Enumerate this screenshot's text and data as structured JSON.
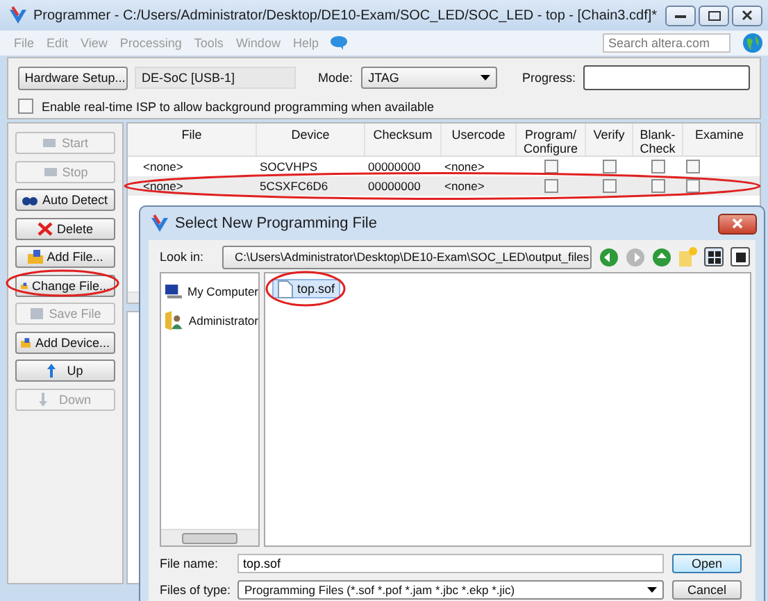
{
  "window": {
    "title": "Programmer - C:/Users/Administrator/Desktop/DE10-Exam/SOC_LED/SOC_LED - top - [Chain3.cdf]*"
  },
  "menu": [
    {
      "label": "File",
      "disabled": true
    },
    {
      "label": "Edit",
      "disabled": true
    },
    {
      "label": "View",
      "disabled": true
    },
    {
      "label": "Processing",
      "disabled": true
    },
    {
      "label": "Tools",
      "disabled": true
    },
    {
      "label": "Window",
      "disabled": true
    },
    {
      "label": "Help",
      "disabled": true
    }
  ],
  "search": {
    "placeholder": "Search altera.com"
  },
  "toolbar": {
    "hardware_button": "Hardware Setup...",
    "hardware": "DE-SoC [USB-1]",
    "mode_label": "Mode:",
    "mode": "JTAG",
    "progress_label": "Progress:",
    "progress": {
      "level": 0
    },
    "isp": {
      "label": "Enable real-time ISP to allow background programming when available",
      "checked": false
    }
  },
  "actions": [
    {
      "label": "Start",
      "disabled": true,
      "highlighted": false
    },
    {
      "label": "Stop",
      "disabled": true,
      "highlighted": false
    },
    {
      "label": "Auto Detect",
      "disabled": false,
      "highlighted": false
    },
    {
      "label": "Delete",
      "disabled": false,
      "highlighted": false
    },
    {
      "label": "Add File...",
      "disabled": false,
      "highlighted": false
    },
    {
      "label": "Change File...",
      "disabled": false,
      "highlighted": true
    },
    {
      "label": "Save File",
      "disabled": true,
      "highlighted": false
    },
    {
      "label": "Add Device...",
      "disabled": false,
      "highlighted": false
    },
    {
      "label": "Up",
      "disabled": false,
      "highlighted": false
    },
    {
      "label": "Down",
      "disabled": true,
      "highlighted": false
    }
  ],
  "table": {
    "columns": [
      "File",
      "Device",
      "Checksum",
      "Usercode",
      "Program/ Configure",
      "Verify",
      "Blank-Check",
      "Examine"
    ],
    "rows": [
      {
        "file": "<none>",
        "device": "SOCVHPS",
        "checksum": "00000000",
        "usercode": "<none>",
        "program": false,
        "verify": false,
        "blank_check": false,
        "examine": false,
        "selected": false,
        "highlighted": false
      },
      {
        "file": "<none>",
        "device": "5CSXFC6D6",
        "checksum": "00000000",
        "usercode": "<none>",
        "program": false,
        "verify": false,
        "blank_check": false,
        "examine": false,
        "selected": true,
        "highlighted": true
      }
    ]
  },
  "dialog": {
    "title": "Select New Programming File",
    "look_in_label": "Look in:",
    "look_in": "C:\\Users\\Administrator\\Desktop\\DE10-Exam\\SOC_LED\\output_files",
    "places": [
      {
        "label": "My Computer"
      },
      {
        "label": "Administrator"
      }
    ],
    "files": [
      {
        "name": "top.sof",
        "selected": true,
        "highlighted": true
      }
    ],
    "file_name_label": "File name:",
    "file_name": "top.sof",
    "file_type_label": "Files of type:",
    "file_type": "Programming Files (*.sof *.pof *.jam *.jbc *.ekp *.jic)",
    "buttons": [
      "Open",
      "Cancel"
    ]
  }
}
